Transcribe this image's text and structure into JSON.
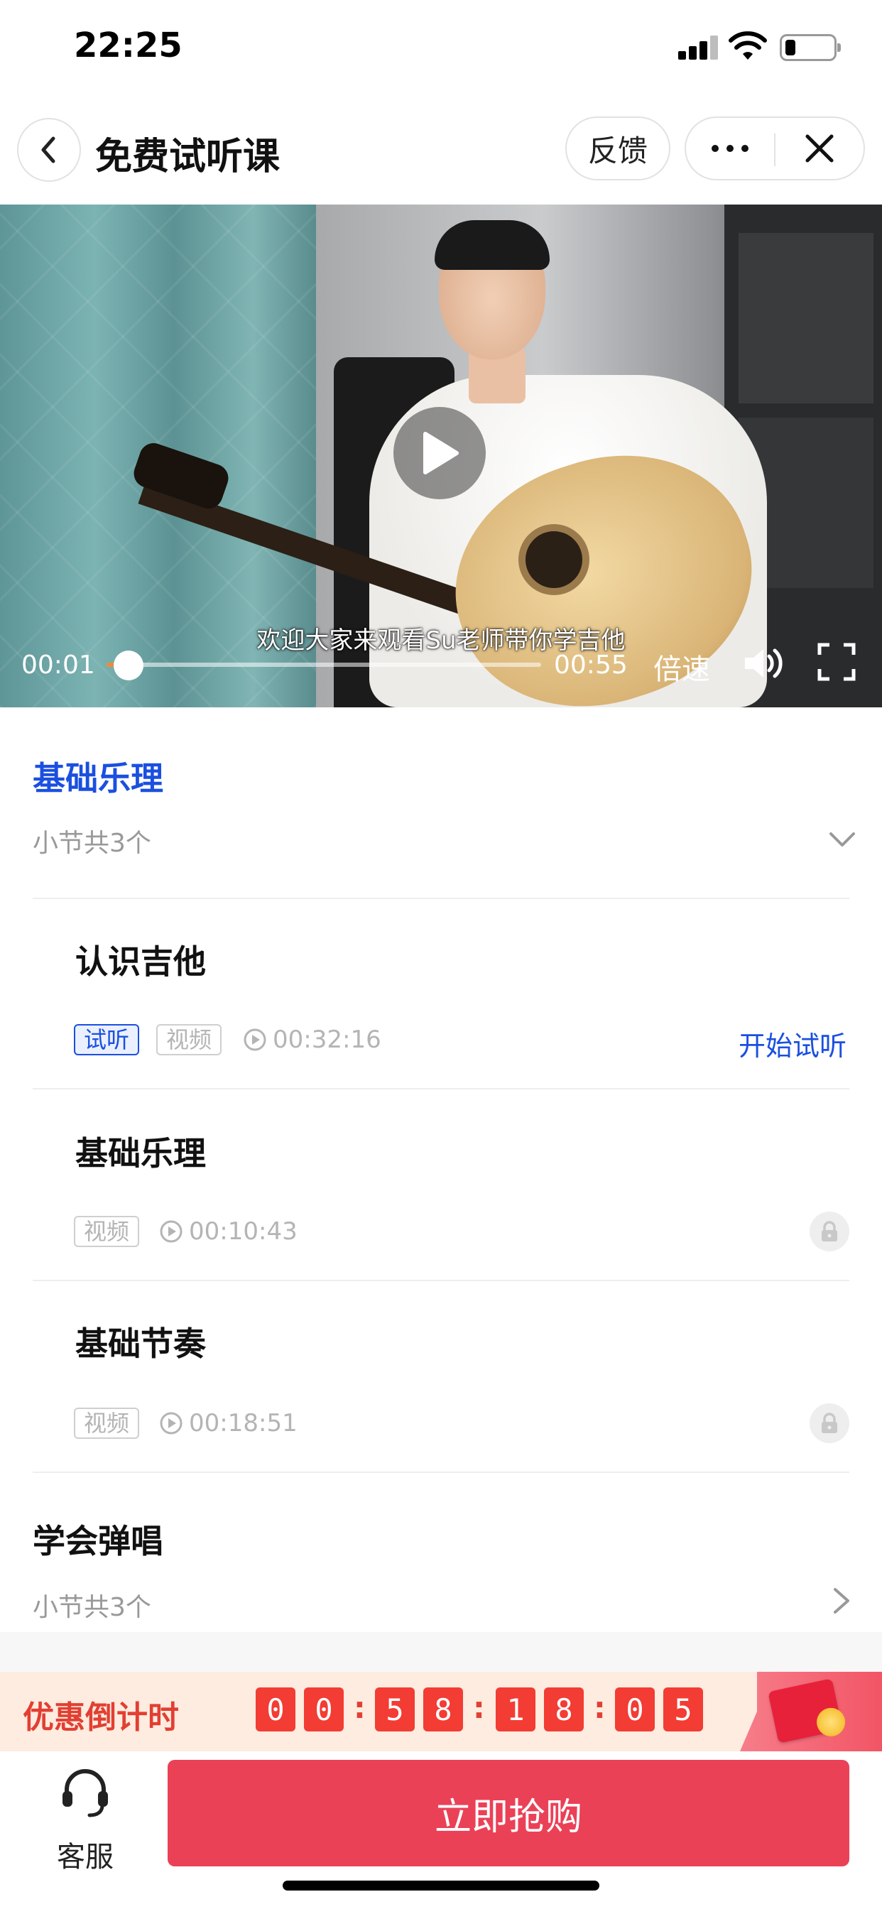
{
  "status_bar": {
    "time": "22:25"
  },
  "nav": {
    "title": "免费试听课",
    "feedback_label": "反馈",
    "more_icon": "more-dots-icon",
    "close_icon": "close-icon",
    "back_icon": "back-chevron-icon"
  },
  "video": {
    "subtitle": "欢迎大家来观看Su老师带你学吉他",
    "current_time": "00:01",
    "total_time": "00:55",
    "progress_fraction": 0.018,
    "speed_label": "倍速",
    "play_icon": "play-icon",
    "volume_icon": "volume-icon",
    "fullscreen_icon": "fullscreen-icon"
  },
  "chapters": [
    {
      "title": "基础乐理",
      "subtitle": "小节共3个",
      "expanded": true,
      "lessons": [
        {
          "title": "认识吉他",
          "tags": [
            "试听",
            "视频"
          ],
          "duration": "00:32:16",
          "action": "开始试听",
          "locked": false
        },
        {
          "title": "基础乐理",
          "tags": [
            "视频"
          ],
          "duration": "00:10:43",
          "locked": true
        },
        {
          "title": "基础节奏",
          "tags": [
            "视频"
          ],
          "duration": "00:18:51",
          "locked": true
        }
      ]
    },
    {
      "title": "学会弹唱",
      "subtitle": "小节共3个",
      "expanded": false
    }
  ],
  "countdown": {
    "label": "优惠倒计时",
    "digits": [
      "0",
      "0",
      "5",
      "8",
      "1",
      "8",
      "0",
      "5"
    ],
    "separator": ":"
  },
  "bottom": {
    "service_label": "客服",
    "buy_label": "立即抢购"
  },
  "colors": {
    "accent_blue": "#1b4fe0",
    "buy_red": "#ea4157",
    "countdown_red": "#f33c33",
    "countdown_bg": "#fdecdf"
  }
}
